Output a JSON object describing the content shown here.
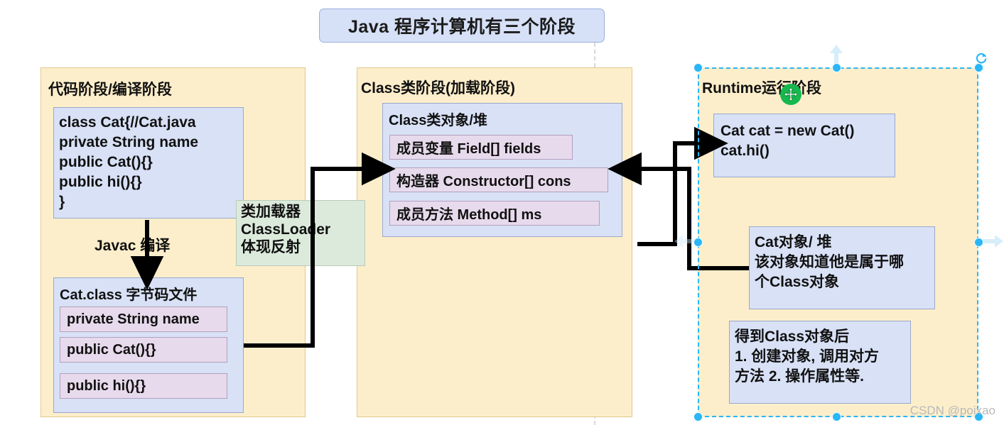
{
  "title_banner": {
    "text": "Java 程序计算机有三个阶段"
  },
  "stages": {
    "code": {
      "title": "代码阶段/编译阶段",
      "source_box": {
        "code": "class Cat{//Cat.java\nprivate String name\npublic Cat(){}\npublic hi(){}\n}"
      },
      "javac_label": "Javac 编译",
      "bytecode_box": {
        "title": "Cat.class 字节码文件",
        "members": [
          "private String name",
          "public Cat(){}",
          "public hi(){}"
        ]
      }
    },
    "classfile": {
      "title": "Class类阶段(加载阶段)",
      "class_object_box": {
        "title": "Class类对象/堆",
        "members": [
          "成员变量 Field[] fields",
          "构造器 Constructor[] cons",
          "成员方法 Method[] ms"
        ]
      }
    },
    "runtime": {
      "title": "Runtime运行阶段",
      "code_box": {
        "code": "Cat cat = new Cat()\ncat.hi()"
      },
      "object_box": {
        "code": "Cat对象/ 堆\n该对象知道他是属于哪\n个Class对象"
      },
      "usage_box": {
        "code": "得到Class对象后\n1. 创建对象, 调用对方\n方法 2. 操作属性等."
      }
    }
  },
  "classloader_note": {
    "text": "类加载器\nClassLoader\n体现反射"
  },
  "selection": {
    "move_handle_icon": "move-cursor-icon",
    "rotate_handle_icon": "rotate-icon"
  },
  "watermark": {
    "text": "CSDN @poixao"
  },
  "colors": {
    "stage_bg": "#fdeecb",
    "stage_border": "#e0c98a",
    "blue_box": "#d8e1f6",
    "blue_border": "#9aa9c9",
    "member_bg": "#e7daec",
    "member_border": "#b3a0bd",
    "banner_bg": "#d6e0f7",
    "banner_border": "#9ab0dd",
    "note_bg": "#dceadc",
    "selection": "#29b6f6",
    "move_handle": "#16b84e"
  }
}
